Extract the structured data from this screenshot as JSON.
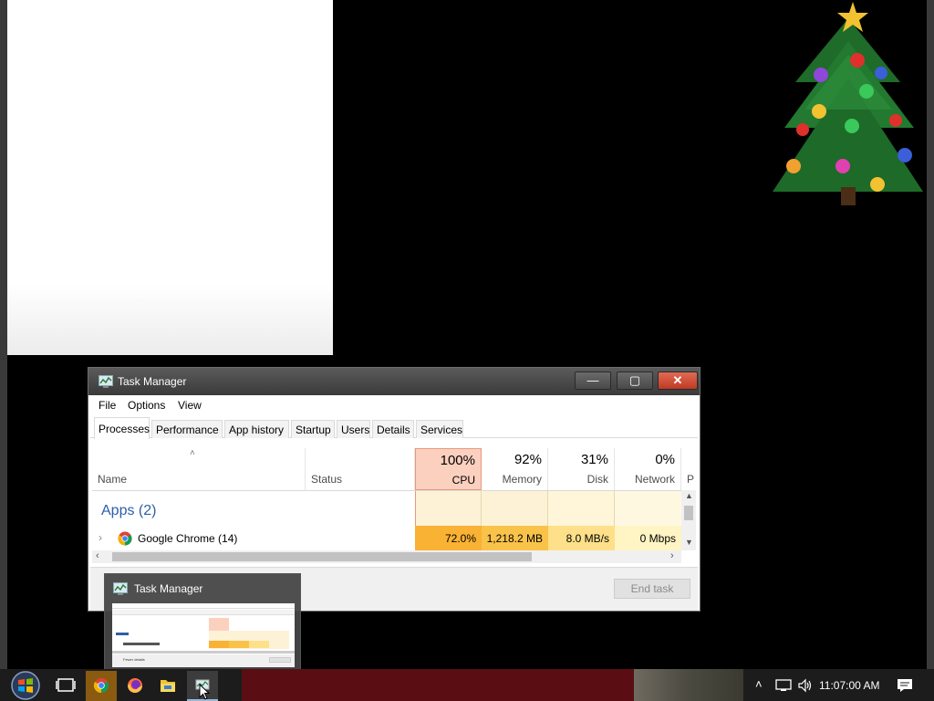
{
  "task_manager": {
    "title": "Task Manager",
    "menu": [
      "File",
      "Options",
      "View"
    ],
    "tabs": [
      "Processes",
      "Performance",
      "App history",
      "Startup",
      "Users",
      "Details",
      "Services"
    ],
    "active_tab": "Processes",
    "columns": {
      "name": "Name",
      "status": "Status",
      "cpu": {
        "pct": "100%",
        "label": "CPU"
      },
      "memory": {
        "pct": "92%",
        "label": "Memory"
      },
      "disk": {
        "pct": "31%",
        "label": "Disk"
      },
      "network": {
        "pct": "0%",
        "label": "Network"
      },
      "power_partial": "P"
    },
    "group_label": "Apps (2)",
    "rows": [
      {
        "name": "Google Chrome (14)",
        "cpu": "72.0%",
        "memory": "1,218.2 MB",
        "disk": "8.0 MB/s",
        "network": "0 Mbps"
      }
    ],
    "end_task_label": "End task",
    "colors": {
      "cpu_header": "#fcd0bf",
      "cpu_cell": "#f9b233",
      "memory_cell": "#f9c34a",
      "disk_cell": "#fde089",
      "network_cell": "#fff4c4",
      "group_label": "#2c5fa8"
    }
  },
  "thumbnail": {
    "title": "Task Manager",
    "fewer_details": "Fewer details"
  },
  "taskbar": {
    "icons": [
      "windows-start-icon",
      "task-view-icon",
      "chrome-icon",
      "firefox-icon",
      "file-explorer-icon",
      "task-manager-icon"
    ],
    "tray_icons": [
      "chevron-up-icon",
      "network-icon",
      "volume-icon",
      "notification-icon"
    ],
    "clock": "11:07:00 AM"
  }
}
